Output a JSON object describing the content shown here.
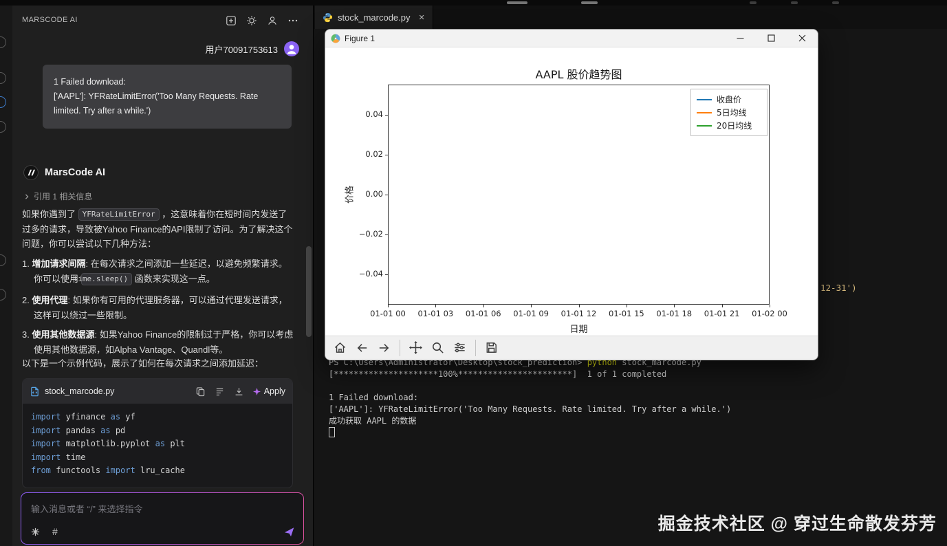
{
  "icons": {
    "new_chat": "plus-square",
    "settings": "gear",
    "share_user": "person",
    "more": "ellipsis",
    "chevron": "chevron-right",
    "copy": "copy-pages",
    "doc": "document-lines",
    "insert": "insert-arrow-down",
    "sparkle": "four-point-star",
    "skills": "asterisk-burst",
    "hash": "#",
    "send": "paper-plane",
    "python": "python-logo",
    "tab_close": "✕",
    "matplotlib": "matplotlib-logo",
    "minimize": "window-minimize",
    "maximize": "window-maximize",
    "close": "window-close",
    "home": "house",
    "back": "arrow-left",
    "forward": "arrow-right",
    "pan": "move-cross-arrows",
    "zoom": "magnifier",
    "configure": "sliders",
    "save": "floppy-disk"
  },
  "sidebar": {
    "title": "MARSCODE AI",
    "user": {
      "name": "用户70091753613"
    },
    "quote": {
      "line1": "1 Failed download:",
      "line2": "['AAPL']: YFRateLimitError('Too Many Requests. Rate limited. Try after a while.')"
    },
    "assistant": {
      "name": "MarsCode AI",
      "reference_label": "引用 1 相关信息",
      "intro": {
        "t1": "如果你遇到了 ",
        "code": "YFRateLimitError",
        "t2": " ，这意味着你在短时间内发送了过多的请求，导致被Yahoo Finance的API限制了访问。为了解决这个问题，你可以尝试以下几种方法："
      },
      "items": [
        {
          "num": "1. ",
          "title": "增加请求间隔",
          "t1": ": 在每次请求之间添加一些延迟，以避免频繁请求。你可以使用 ",
          "code": "time.sleep()",
          "t2": " 函数来实现这一点。"
        },
        {
          "num": "2. ",
          "title": "使用代理",
          "t1": ": 如果你有可用的代理服务器，可以通过代理发送请求，这样可以绕过一些限制。"
        },
        {
          "num": "3. ",
          "title": "使用其他数据源",
          "t1": ": 如果Yahoo Finance的限制过于严格，你可以考虑使用其他数据源，如Alpha Vantage、Quandl等。"
        }
      ],
      "closing": "以下是一个示例代码，展示了如何在每次请求之间添加延迟："
    },
    "code_card": {
      "filename": "stock_marcode.py",
      "apply_label": "Apply",
      "lines": [
        [
          {
            "t": "import",
            "c": "kw"
          },
          {
            "t": " yfinance ",
            "c": "id"
          },
          {
            "t": "as",
            "c": "kw"
          },
          {
            "t": " yf",
            "c": "id"
          }
        ],
        [
          {
            "t": "import",
            "c": "kw"
          },
          {
            "t": " pandas ",
            "c": "id"
          },
          {
            "t": "as",
            "c": "kw"
          },
          {
            "t": " pd",
            "c": "id"
          }
        ],
        [
          {
            "t": "import",
            "c": "kw"
          },
          {
            "t": " matplotlib.pyplot ",
            "c": "id"
          },
          {
            "t": "as",
            "c": "kw"
          },
          {
            "t": " plt",
            "c": "id"
          }
        ],
        [
          {
            "t": "import",
            "c": "kw"
          },
          {
            "t": " time",
            "c": "id"
          }
        ],
        [
          {
            "t": "from",
            "c": "kw"
          },
          {
            "t": " functools ",
            "c": "id"
          },
          {
            "t": "import",
            "c": "kw"
          },
          {
            "t": " lru_cache",
            "c": "id"
          }
        ]
      ]
    },
    "input": {
      "placeholder": "输入消息或者 “/” 来选择指令",
      "hash": "#"
    }
  },
  "editor": {
    "tab": {
      "label": "stock_marcode.py"
    },
    "code_fragment": "12-31')",
    "terminal": {
      "lines": [
        [
          {
            "t": "PS C:\\Users\\Administrator\\Desktop\\stock_prediction> ",
            "c": "plain"
          },
          {
            "t": "python",
            "c": "cmd"
          },
          {
            "t": " stock_marcode.py",
            "c": "plain"
          }
        ],
        [
          {
            "t": "[*********************100%***********************]  1 of 1 completed",
            "c": "plain"
          }
        ],
        [],
        [
          {
            "t": "1 Failed download:",
            "c": "plain"
          }
        ],
        [
          {
            "t": "['AAPL']: YFRateLimitError('Too Many Requests. Rate limited. Try after a while.')",
            "c": "plain"
          }
        ],
        [
          {
            "t": "成功获取 AAPL 的数据",
            "c": "plain"
          }
        ]
      ]
    },
    "watermark": "掘金技术社区 @ 穿过生命散发芬芳"
  },
  "figure_window": {
    "title": "Figure 1",
    "chart_data": {
      "type": "line",
      "title": "AAPL 股价趋势图",
      "xlabel": "日期",
      "ylabel": "价格",
      "x_ticks": [
        "01-01 00",
        "01-01 03",
        "01-01 06",
        "01-01 09",
        "01-01 12",
        "01-01 15",
        "01-01 18",
        "01-01 21",
        "01-02 00"
      ],
      "y_ticks": [
        "0.04",
        "0.02",
        "0.00",
        "−0.02",
        "−0.04"
      ],
      "ylim": [
        -0.05,
        0.05
      ],
      "grid": false,
      "legend_position": "upper right",
      "legend": [
        {
          "label": "收盘价",
          "color": "#1f77b4"
        },
        {
          "label": "5日均线",
          "color": "#ff7f0e"
        },
        {
          "label": "20日均线",
          "color": "#2ca02c"
        }
      ],
      "series": [
        {
          "name": "收盘价",
          "color": "#1f77b4",
          "x": [],
          "y": []
        },
        {
          "name": "5日均线",
          "color": "#ff7f0e",
          "x": [],
          "y": []
        },
        {
          "name": "20日均线",
          "color": "#2ca02c",
          "x": [],
          "y": []
        }
      ]
    }
  }
}
